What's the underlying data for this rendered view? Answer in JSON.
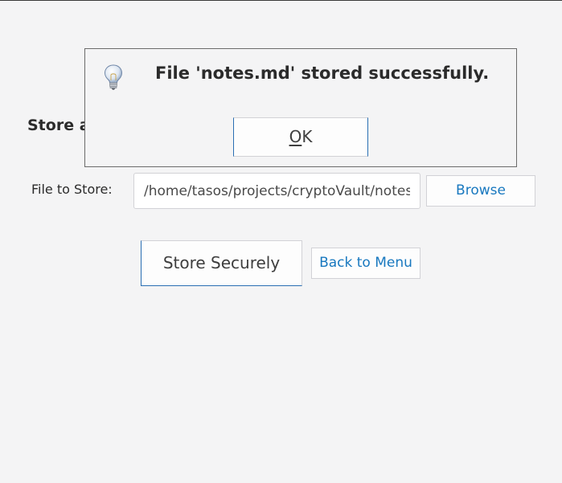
{
  "form": {
    "section_title": "Store a",
    "file_label": "File to Store:",
    "file_path_value": "/home/tasos/projects/cryptoVault/notes.md",
    "browse_label": "Browse",
    "store_label": "Store Securely",
    "back_label": "Back to Menu"
  },
  "dialog": {
    "icon": "lightbulb-icon",
    "message": "File 'notes.md' stored successfully.",
    "ok_mnemonic": "O",
    "ok_rest": "K"
  },
  "colors": {
    "background": "#f4f4f5",
    "link_blue": "#1878bf",
    "focus_border": "#2a6fb3",
    "text_dark": "#2b2b2b"
  }
}
